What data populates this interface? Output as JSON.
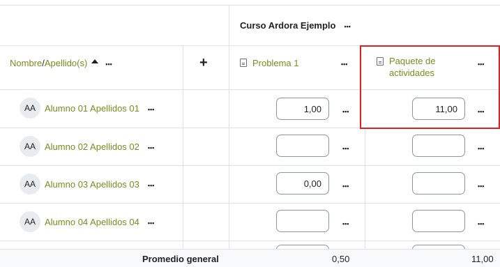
{
  "course": {
    "title": "Curso Ardora Ejemplo"
  },
  "header": {
    "name_label": "Nombre",
    "separator": " / ",
    "surname_label": "Apellido(s)",
    "add_icon": "plus-icon",
    "items": [
      {
        "label": "Problema 1",
        "icon": "document-icon"
      },
      {
        "label_line1": "Paquete de",
        "label_line2": "actividades",
        "icon": "document-icon"
      }
    ]
  },
  "students": [
    {
      "initials": "AA",
      "name": "Alumno 01 Apellidos 01",
      "grades": [
        "1,00",
        "11,00"
      ]
    },
    {
      "initials": "AA",
      "name": "Alumno 02 Apellidos 02",
      "grades": [
        "",
        ""
      ]
    },
    {
      "initials": "AA",
      "name": "Alumno 03 Apellidos 03",
      "grades": [
        "0,00",
        ""
      ]
    },
    {
      "initials": "AA",
      "name": "Alumno 04 Apellidos 04",
      "grades": [
        "",
        ""
      ]
    }
  ],
  "footer": {
    "label": "Promedio general",
    "averages": [
      "0,50",
      "11,00"
    ]
  },
  "colors": {
    "link": "#7a8b1f",
    "highlight": "#e02020",
    "border": "#dee2e6"
  }
}
